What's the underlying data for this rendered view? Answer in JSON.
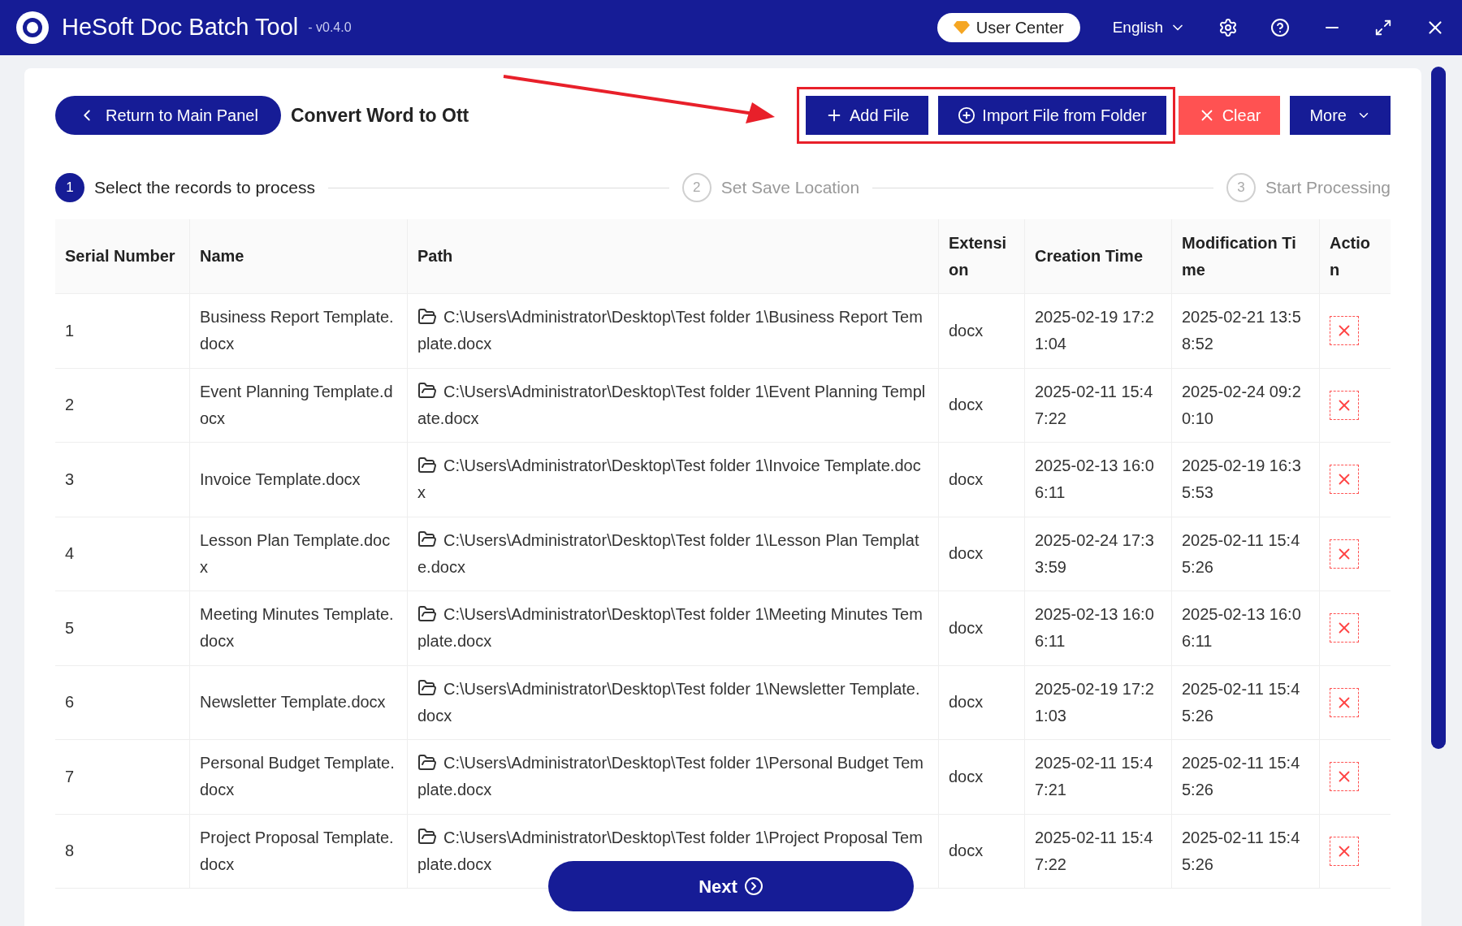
{
  "window": {
    "title": "HeSoft Doc Batch Tool",
    "version": "- v0.4.0",
    "user_center": "User Center",
    "language": "English"
  },
  "toolbar": {
    "back": "Return to Main Panel",
    "heading": "Convert Word to Ott",
    "add_file": "Add File",
    "import_folder": "Import File from Folder",
    "clear": "Clear",
    "more": "More"
  },
  "steps": [
    {
      "number": "1",
      "label": "Select the records to process",
      "selected": true
    },
    {
      "number": "2",
      "label": "Set Save Location",
      "selected": false
    },
    {
      "number": "3",
      "label": "Start Processing",
      "selected": false
    }
  ],
  "table": {
    "columns": [
      "Serial Number",
      "Name",
      "Path",
      "Extension",
      "Creation Time",
      "Modification Time",
      "Action"
    ],
    "rows": [
      {
        "serial": "1",
        "name": "Business Report Template.docx",
        "path": "C:\\Users\\Administrator\\Desktop\\Test folder 1\\Business Report Template.docx",
        "extension": "docx",
        "created": "2025-02-19 17:21:04",
        "modified": "2025-02-21 13:58:52"
      },
      {
        "serial": "2",
        "name": "Event Planning Template.docx",
        "path": "C:\\Users\\Administrator\\Desktop\\Test folder 1\\Event Planning Template.docx",
        "extension": "docx",
        "created": "2025-02-11 15:47:22",
        "modified": "2025-02-24 09:20:10"
      },
      {
        "serial": "3",
        "name": "Invoice Template.docx",
        "path": "C:\\Users\\Administrator\\Desktop\\Test folder 1\\Invoice Template.docx",
        "extension": "docx",
        "created": "2025-02-13 16:06:11",
        "modified": "2025-02-19 16:35:53"
      },
      {
        "serial": "4",
        "name": "Lesson Plan Template.docx",
        "path": "C:\\Users\\Administrator\\Desktop\\Test folder 1\\Lesson Plan Template.docx",
        "extension": "docx",
        "created": "2025-02-24 17:33:59",
        "modified": "2025-02-11 15:45:26"
      },
      {
        "serial": "5",
        "name": "Meeting Minutes Template.docx",
        "path": "C:\\Users\\Administrator\\Desktop\\Test folder 1\\Meeting Minutes Template.docx",
        "extension": "docx",
        "created": "2025-02-13 16:06:11",
        "modified": "2025-02-13 16:06:11"
      },
      {
        "serial": "6",
        "name": "Newsletter Template.docx",
        "path": "C:\\Users\\Administrator\\Desktop\\Test folder 1\\Newsletter Template.docx",
        "extension": "docx",
        "created": "2025-02-19 17:21:03",
        "modified": "2025-02-11 15:45:26"
      },
      {
        "serial": "7",
        "name": "Personal Budget Template.docx",
        "path": "C:\\Users\\Administrator\\Desktop\\Test folder 1\\Personal Budget Template.docx",
        "extension": "docx",
        "created": "2025-02-11 15:47:21",
        "modified": "2025-02-11 15:45:26"
      },
      {
        "serial": "8",
        "name": "Project Proposal Template.docx",
        "path": "C:\\Users\\Administrator\\Desktop\\Test folder 1\\Project Proposal Template.docx",
        "extension": "docx",
        "created": "2025-02-11 15:47:22",
        "modified": "2025-02-11 15:45:26"
      }
    ]
  },
  "footer": {
    "next": "Next"
  }
}
